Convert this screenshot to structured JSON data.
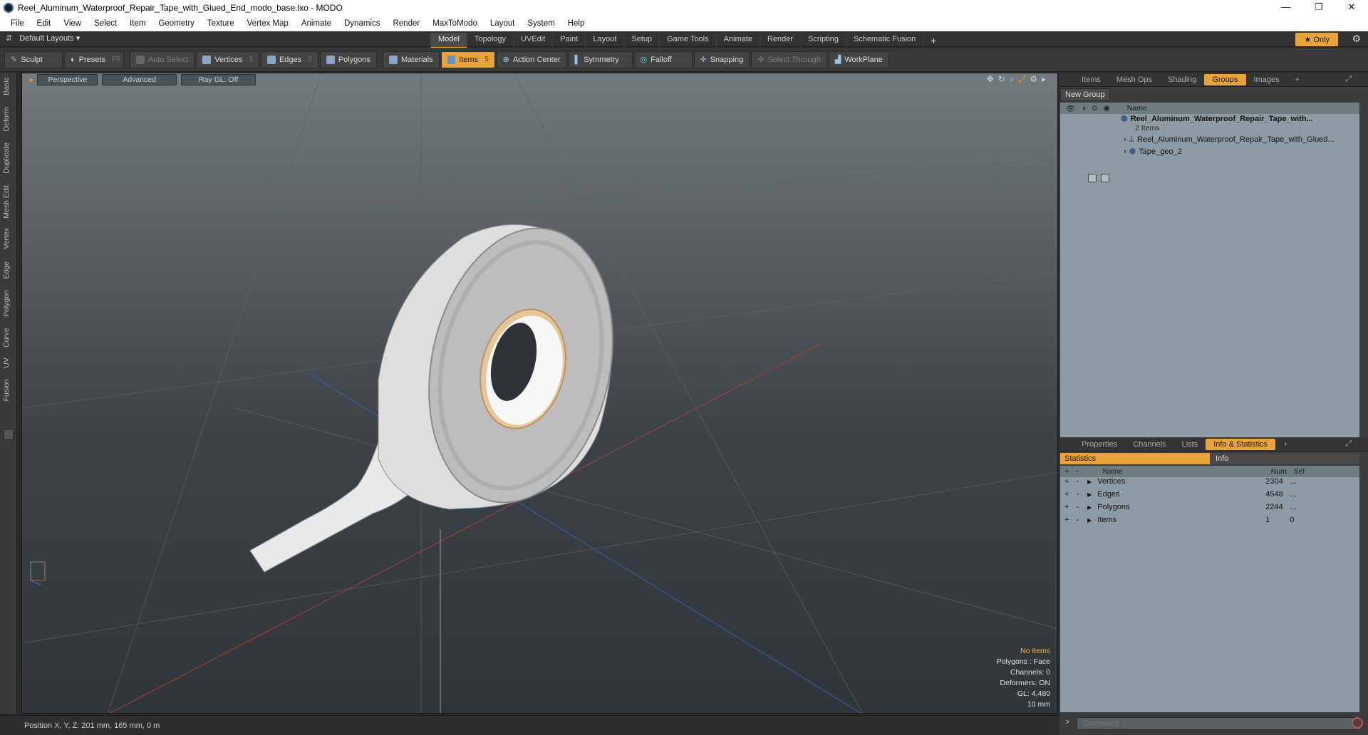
{
  "window": {
    "title": "Reel_Aluminum_Waterproof_Repair_Tape_with_Glued_End_modo_base.lxo - MODO",
    "controls": [
      "—",
      "❐",
      "✕"
    ]
  },
  "menu": [
    "File",
    "Edit",
    "View",
    "Select",
    "Item",
    "Geometry",
    "Texture",
    "Vertex Map",
    "Animate",
    "Dynamics",
    "Render",
    "MaxToModo",
    "Layout",
    "System",
    "Help"
  ],
  "layoutbar": {
    "layouts_label": "Default Layouts ▾",
    "tabs": [
      "Model",
      "Topology",
      "UVEdit",
      "Paint",
      "Layout",
      "Setup",
      "Game Tools",
      "Animate",
      "Render",
      "Scripting",
      "Schematic Fusion"
    ],
    "active_tab": "Model",
    "add": "+",
    "only_label": "★  Only"
  },
  "toolbar": {
    "sculpt": "Sculpt",
    "presets": "Presets",
    "presets_key": "F6",
    "auto_select": "Auto Select",
    "vertices": "Vertices",
    "vertices_num": "1",
    "edges": "Edges",
    "edges_num": "2",
    "polygons": "Polygons",
    "materials": "Materials",
    "items": "Items",
    "items_num": "5",
    "action_center": "Action Center",
    "symmetry": "Symmetry",
    "falloff": "Falloff",
    "snapping": "Snapping",
    "select_through": "Select Through",
    "workplane": "WorkPlane"
  },
  "left_tabs": [
    "Basic",
    "Deform",
    "Duplicate",
    "Mesh Edit",
    "Vertex",
    "Edge",
    "Polygon",
    "Curve",
    "UV",
    "Fusion"
  ],
  "viewport": {
    "perspective": "Perspective",
    "advanced": "Advanced",
    "raygl": "Ray GL: Off",
    "stats": {
      "no_items": "No Items",
      "polygons": "Polygons : Face",
      "channels": "Channels: 0",
      "deformers": "Deformers: ON",
      "gl": "GL: 4,480",
      "scale": "10 mm"
    }
  },
  "statusbar": {
    "position": "Position X, Y, Z:   201 mm, 165 mm, 0 m"
  },
  "top_panel": {
    "tabs": [
      "Items",
      "Mesh Ops",
      "Shading",
      "Groups",
      "Images"
    ],
    "active_tab": "Groups",
    "new_group": "New Group",
    "name_header": "Name",
    "group_name": "Reel_Aluminum_Waterproof_Repair_Tape_with...",
    "group_count": "2 Items",
    "children": [
      "Reel_Aluminum_Waterproof_Repair_Tape_with_Glued...",
      "Tape_geo_2"
    ]
  },
  "bottom_panel": {
    "tabs": [
      "Properties",
      "Channels",
      "Lists",
      "Info & Statistics"
    ],
    "active_tab": "Info & Statistics",
    "sub_tabs": [
      "Statistics",
      "Info"
    ],
    "headers": {
      "name": "Name",
      "num": "Num",
      "sel": "Sel"
    },
    "rows": [
      {
        "name": "Vertices",
        "num": "2304",
        "sel": "..."
      },
      {
        "name": "Edges",
        "num": "4548",
        "sel": "..."
      },
      {
        "name": "Polygons",
        "num": "2244",
        "sel": "..."
      },
      {
        "name": "Items",
        "num": "1",
        "sel": "0"
      }
    ],
    "command_placeholder": "Command"
  },
  "colors": {
    "accent": "#e8a33a",
    "panel_blue": "#8e9ba4"
  }
}
